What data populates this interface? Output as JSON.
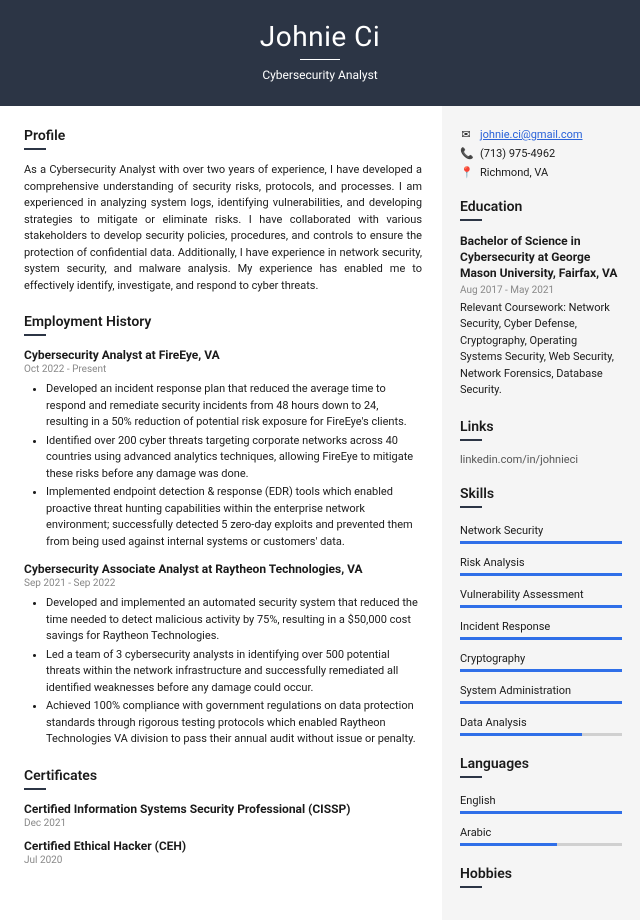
{
  "header": {
    "name": "Johnie Ci",
    "title": "Cybersecurity Analyst"
  },
  "profile": {
    "heading": "Profile",
    "text": "As a Cybersecurity Analyst with over two years of experience, I have developed a comprehensive understanding of security risks, protocols, and processes. I am experienced in analyzing system logs, identifying vulnerabilities, and developing strategies to mitigate or eliminate risks. I have collaborated with various stakeholders to develop security policies, procedures, and controls to ensure the protection of confidential data. Additionally, I have experience in network security, system security, and malware analysis. My experience has enabled me to effectively identify, investigate, and respond to cyber threats."
  },
  "employment": {
    "heading": "Employment History",
    "jobs": [
      {
        "title": "Cybersecurity Analyst at FireEye, VA",
        "dates": "Oct 2022 - Present",
        "bullets": [
          "Developed an incident response plan that reduced the average time to respond and remediate security incidents from 48 hours down to 24, resulting in a 50% reduction of potential risk exposure for FireEye's clients.",
          "Identified over 200 cyber threats targeting corporate networks across 40 countries using advanced analytics techniques, allowing FireEye to mitigate these risks before any damage was done.",
          "Implemented endpoint detection & response (EDR) tools which enabled proactive threat hunting capabilities within the enterprise network environment; successfully detected 5 zero-day exploits and prevented them from being used against internal systems or customers' data."
        ]
      },
      {
        "title": "Cybersecurity Associate Analyst at Raytheon Technologies, VA",
        "dates": "Sep 2021 - Sep 2022",
        "bullets": [
          "Developed and implemented an automated security system that reduced the time needed to detect malicious activity by 75%, resulting in a $50,000 cost savings for Raytheon Technologies.",
          "Led a team of 3 cybersecurity analysts in identifying over 500 potential threats within the network infrastructure and successfully remediated all identified weaknesses before any damage could occur.",
          "Achieved 100% compliance with government regulations on data protection standards through rigorous testing protocols which enabled Raytheon Technologies VA division to pass their annual audit without issue or penalty."
        ]
      }
    ]
  },
  "certificates": {
    "heading": "Certificates",
    "items": [
      {
        "title": "Certified Information Systems Security Professional (CISSP)",
        "date": "Dec 2021"
      },
      {
        "title": "Certified Ethical Hacker (CEH)",
        "date": "Jul 2020"
      }
    ]
  },
  "contact": {
    "email": "johnie.ci@gmail.com",
    "phone": "(713) 975-4962",
    "location": "Richmond, VA"
  },
  "education": {
    "heading": "Education",
    "degree": "Bachelor of Science in Cybersecurity at George Mason University, Fairfax, VA",
    "dates": "Aug 2017 - May 2021",
    "desc": "Relevant Coursework: Network Security, Cyber Defense, Cryptography, Operating Systems Security, Web Security, Network Forensics, Database Security."
  },
  "links": {
    "heading": "Links",
    "items": [
      "linkedin.com/in/johnieci"
    ]
  },
  "skills": {
    "heading": "Skills",
    "items": [
      {
        "name": "Network Security",
        "level": 100
      },
      {
        "name": "Risk Analysis",
        "level": 100
      },
      {
        "name": "Vulnerability Assessment",
        "level": 100
      },
      {
        "name": "Incident Response",
        "level": 100
      },
      {
        "name": "Cryptography",
        "level": 100
      },
      {
        "name": "System Administration",
        "level": 100
      },
      {
        "name": "Data Analysis",
        "level": 75
      }
    ]
  },
  "languages": {
    "heading": "Languages",
    "items": [
      {
        "name": "English",
        "level": 100
      },
      {
        "name": "Arabic",
        "level": 60
      }
    ]
  },
  "hobbies": {
    "heading": "Hobbies"
  }
}
